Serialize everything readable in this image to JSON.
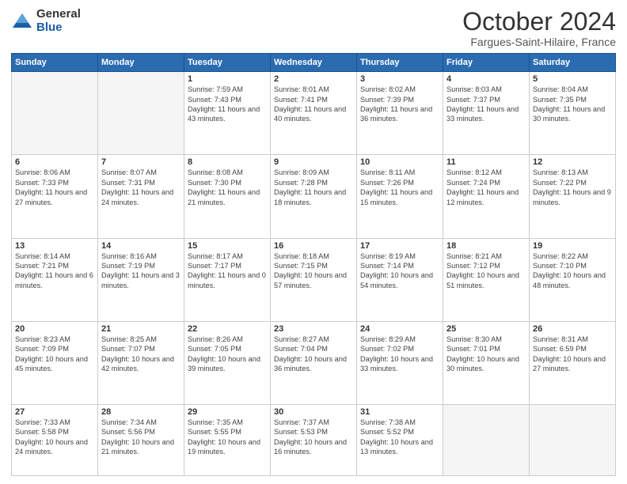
{
  "logo": {
    "general": "General",
    "blue": "Blue"
  },
  "title": "October 2024",
  "location": "Fargues-Saint-Hilaire, France",
  "days_header": [
    "Sunday",
    "Monday",
    "Tuesday",
    "Wednesday",
    "Thursday",
    "Friday",
    "Saturday"
  ],
  "weeks": [
    [
      {
        "day": "",
        "info": ""
      },
      {
        "day": "",
        "info": ""
      },
      {
        "day": "1",
        "info": "Sunrise: 7:59 AM\nSunset: 7:43 PM\nDaylight: 11 hours and 43 minutes."
      },
      {
        "day": "2",
        "info": "Sunrise: 8:01 AM\nSunset: 7:41 PM\nDaylight: 11 hours and 40 minutes."
      },
      {
        "day": "3",
        "info": "Sunrise: 8:02 AM\nSunset: 7:39 PM\nDaylight: 11 hours and 36 minutes."
      },
      {
        "day": "4",
        "info": "Sunrise: 8:03 AM\nSunset: 7:37 PM\nDaylight: 11 hours and 33 minutes."
      },
      {
        "day": "5",
        "info": "Sunrise: 8:04 AM\nSunset: 7:35 PM\nDaylight: 11 hours and 30 minutes."
      }
    ],
    [
      {
        "day": "6",
        "info": "Sunrise: 8:06 AM\nSunset: 7:33 PM\nDaylight: 11 hours and 27 minutes."
      },
      {
        "day": "7",
        "info": "Sunrise: 8:07 AM\nSunset: 7:31 PM\nDaylight: 11 hours and 24 minutes."
      },
      {
        "day": "8",
        "info": "Sunrise: 8:08 AM\nSunset: 7:30 PM\nDaylight: 11 hours and 21 minutes."
      },
      {
        "day": "9",
        "info": "Sunrise: 8:09 AM\nSunset: 7:28 PM\nDaylight: 11 hours and 18 minutes."
      },
      {
        "day": "10",
        "info": "Sunrise: 8:11 AM\nSunset: 7:26 PM\nDaylight: 11 hours and 15 minutes."
      },
      {
        "day": "11",
        "info": "Sunrise: 8:12 AM\nSunset: 7:24 PM\nDaylight: 11 hours and 12 minutes."
      },
      {
        "day": "12",
        "info": "Sunrise: 8:13 AM\nSunset: 7:22 PM\nDaylight: 11 hours and 9 minutes."
      }
    ],
    [
      {
        "day": "13",
        "info": "Sunrise: 8:14 AM\nSunset: 7:21 PM\nDaylight: 11 hours and 6 minutes."
      },
      {
        "day": "14",
        "info": "Sunrise: 8:16 AM\nSunset: 7:19 PM\nDaylight: 11 hours and 3 minutes."
      },
      {
        "day": "15",
        "info": "Sunrise: 8:17 AM\nSunset: 7:17 PM\nDaylight: 11 hours and 0 minutes."
      },
      {
        "day": "16",
        "info": "Sunrise: 8:18 AM\nSunset: 7:15 PM\nDaylight: 10 hours and 57 minutes."
      },
      {
        "day": "17",
        "info": "Sunrise: 8:19 AM\nSunset: 7:14 PM\nDaylight: 10 hours and 54 minutes."
      },
      {
        "day": "18",
        "info": "Sunrise: 8:21 AM\nSunset: 7:12 PM\nDaylight: 10 hours and 51 minutes."
      },
      {
        "day": "19",
        "info": "Sunrise: 8:22 AM\nSunset: 7:10 PM\nDaylight: 10 hours and 48 minutes."
      }
    ],
    [
      {
        "day": "20",
        "info": "Sunrise: 8:23 AM\nSunset: 7:09 PM\nDaylight: 10 hours and 45 minutes."
      },
      {
        "day": "21",
        "info": "Sunrise: 8:25 AM\nSunset: 7:07 PM\nDaylight: 10 hours and 42 minutes."
      },
      {
        "day": "22",
        "info": "Sunrise: 8:26 AM\nSunset: 7:05 PM\nDaylight: 10 hours and 39 minutes."
      },
      {
        "day": "23",
        "info": "Sunrise: 8:27 AM\nSunset: 7:04 PM\nDaylight: 10 hours and 36 minutes."
      },
      {
        "day": "24",
        "info": "Sunrise: 8:29 AM\nSunset: 7:02 PM\nDaylight: 10 hours and 33 minutes."
      },
      {
        "day": "25",
        "info": "Sunrise: 8:30 AM\nSunset: 7:01 PM\nDaylight: 10 hours and 30 minutes."
      },
      {
        "day": "26",
        "info": "Sunrise: 8:31 AM\nSunset: 6:59 PM\nDaylight: 10 hours and 27 minutes."
      }
    ],
    [
      {
        "day": "27",
        "info": "Sunrise: 7:33 AM\nSunset: 5:58 PM\nDaylight: 10 hours and 24 minutes."
      },
      {
        "day": "28",
        "info": "Sunrise: 7:34 AM\nSunset: 5:56 PM\nDaylight: 10 hours and 21 minutes."
      },
      {
        "day": "29",
        "info": "Sunrise: 7:35 AM\nSunset: 5:55 PM\nDaylight: 10 hours and 19 minutes."
      },
      {
        "day": "30",
        "info": "Sunrise: 7:37 AM\nSunset: 5:53 PM\nDaylight: 10 hours and 16 minutes."
      },
      {
        "day": "31",
        "info": "Sunrise: 7:38 AM\nSunset: 5:52 PM\nDaylight: 10 hours and 13 minutes."
      },
      {
        "day": "",
        "info": ""
      },
      {
        "day": "",
        "info": ""
      }
    ]
  ]
}
